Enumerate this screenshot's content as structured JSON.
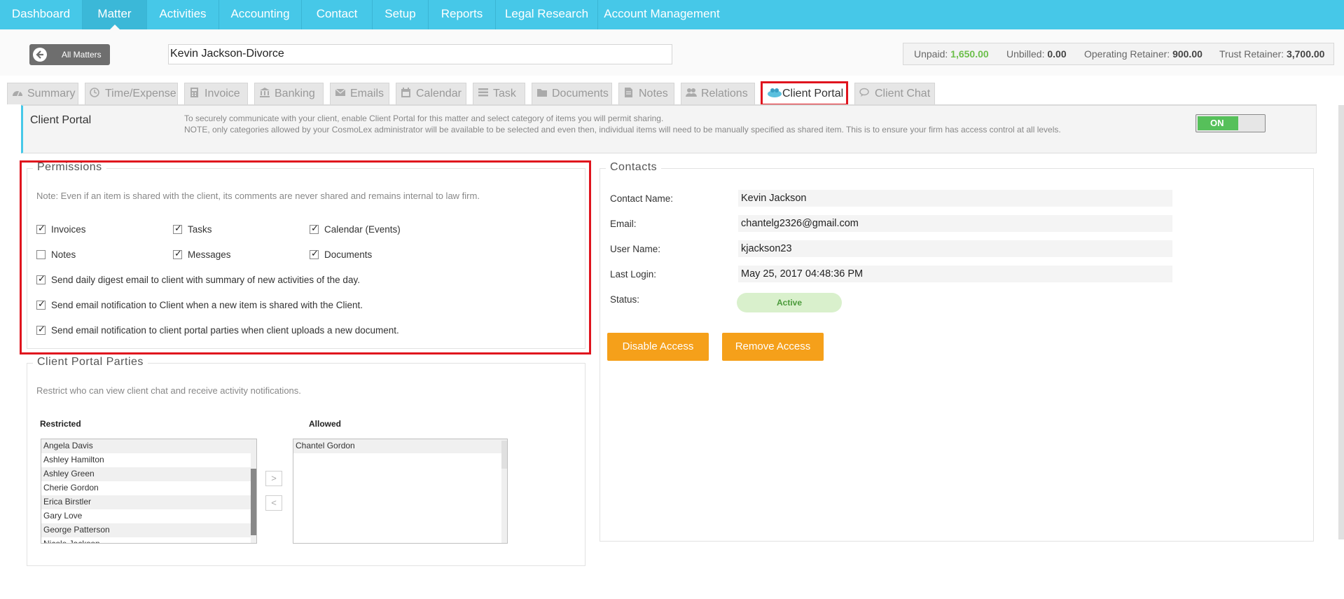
{
  "nav": {
    "items": [
      "Dashboard",
      "Matter",
      "Activities",
      "Accounting",
      "Contact",
      "Setup",
      "Reports",
      "Legal Research",
      "Account Management"
    ],
    "active": "Matter"
  },
  "header": {
    "back_label": "All Matters",
    "matter_name": "Kevin Jackson-Divorce",
    "balances": {
      "unpaid_label": "Unpaid:",
      "unpaid_value": "1,650.00",
      "unbilled_label": "Unbilled:",
      "unbilled_value": "0.00",
      "operating_label": "Operating Retainer:",
      "operating_value": "900.00",
      "trust_label": "Trust Retainer:",
      "trust_value": "3,700.00"
    }
  },
  "tabs": [
    "Summary",
    "Time/Expense",
    "Invoice",
    "Banking",
    "Emails",
    "Calendar",
    "Task",
    "Documents",
    "Notes",
    "Relations",
    "Client Portal",
    "Client Chat"
  ],
  "tab_icons": [
    "dashboard-icon",
    "clock-icon",
    "calculator-icon",
    "bank-icon",
    "envelope-icon",
    "calendar-icon",
    "task-list-icon",
    "folder-icon",
    "note-icon",
    "users-icon",
    "client-portal-icon",
    "chat-icon"
  ],
  "active_tab": "Client Portal",
  "client_portal": {
    "title": "Client Portal",
    "desc_line1": "To securely communicate with your client, enable Client Portal for this matter and select category of items you will permit sharing.",
    "desc_line2": "NOTE, only categories allowed by your CosmoLex administrator will be available to be selected and even then, individual items will need to be manually specified as shared item. This is to ensure your firm has access control at all levels.",
    "toggle_label": "ON"
  },
  "permissions": {
    "legend": "Permissions",
    "note": "Note: Even if an item is shared with the client, its comments are never shared and remains internal to law firm.",
    "grid": [
      {
        "label": "Invoices",
        "checked": true
      },
      {
        "label": "Tasks",
        "checked": true
      },
      {
        "label": "Calendar (Events)",
        "checked": true
      },
      {
        "label": "Notes",
        "checked": false
      },
      {
        "label": "Messages",
        "checked": true
      },
      {
        "label": "Documents",
        "checked": true
      }
    ],
    "options": [
      {
        "label": "Send daily digest email to client with summary of new activities of the day.",
        "checked": true
      },
      {
        "label": "Send email notification to Client when a new item is shared with the Client.",
        "checked": true
      },
      {
        "label": "Send email notification to client portal parties when client uploads a new document.",
        "checked": true
      }
    ]
  },
  "parties": {
    "legend": "Client Portal Parties",
    "note": "Restrict who can view client chat and receive activity notifications.",
    "restricted_label": "Restricted",
    "allowed_label": "Allowed",
    "restricted": [
      "Angela Davis",
      "Ashley Hamilton",
      "Ashley Green",
      "Cherie Gordon",
      "Erica Birstler",
      "Gary Love",
      "George Patterson",
      "Nicole Jackson"
    ],
    "allowed": [
      "Chantel Gordon"
    ],
    "move_right": ">",
    "move_left": "<"
  },
  "contacts": {
    "legend": "Contacts",
    "name_label": "Contact Name:",
    "name_value": "Kevin Jackson",
    "email_label": "Email:",
    "email_value": "chantelg2326@gmail.com",
    "user_label": "User Name:",
    "user_value": "kjackson23",
    "login_label": "Last Login:",
    "login_value": "May 25, 2017 04:48:36 PM",
    "status_label": "Status:",
    "status_value": "Active",
    "disable_label": "Disable Access",
    "remove_label": "Remove Access"
  },
  "colors": {
    "nav_bg": "#46c8e8",
    "highlight": "#e0141e",
    "toggle_on": "#56c05a",
    "action_button": "#f5a01a",
    "status_active": "#d9f0cc"
  }
}
